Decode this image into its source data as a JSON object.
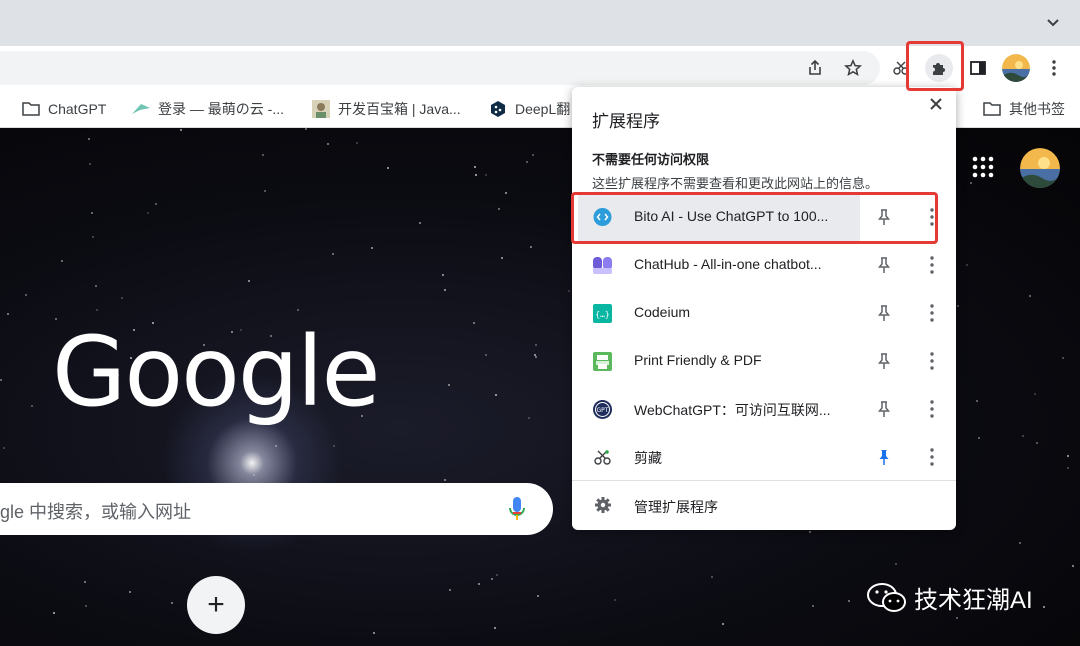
{
  "bookmarks": [
    {
      "label": "ChatGPT",
      "icon": "folder-icon"
    },
    {
      "label": "登录 — 最萌の云 -...",
      "icon": "cloud-logo-icon"
    },
    {
      "label": "开发百宝箱 | Java...",
      "icon": "avatar-icon"
    },
    {
      "label": "DeepL翻",
      "icon": "deepl-icon"
    }
  ],
  "other_bookmarks": "其他书签",
  "search": {
    "placeholder": "gle 中搜索，或输入网址"
  },
  "ntp": {
    "logo": "Google",
    "add_shortcut": "+"
  },
  "watermark": "技术狂潮AI",
  "extensions_popup": {
    "title": "扩展程序",
    "section_title": "不需要任何访问权限",
    "section_desc": "这些扩展程序不需要查看和更改此网站上的信息。",
    "items": [
      {
        "name": "Bito AI - Use ChatGPT to 100...",
        "icon": "bito-icon",
        "pinned": false,
        "highlighted": true
      },
      {
        "name": "ChatHub - All-in-one chatbot...",
        "icon": "chathub-icon",
        "pinned": false
      },
      {
        "name": "Codeium",
        "icon": "codeium-icon",
        "pinned": false
      },
      {
        "name": "Print Friendly & PDF",
        "icon": "print-friendly-icon",
        "pinned": false
      },
      {
        "name": "WebChatGPT：可访问互联网...",
        "icon": "webchatgpt-icon",
        "pinned": false
      },
      {
        "name": "剪藏",
        "icon": "clip-icon",
        "pinned": true
      }
    ],
    "manage_label": "管理扩展程序"
  },
  "colors": {
    "accent": "#1a73e8",
    "annotation": "#e53935",
    "highlight_row": "#e8eaed"
  }
}
